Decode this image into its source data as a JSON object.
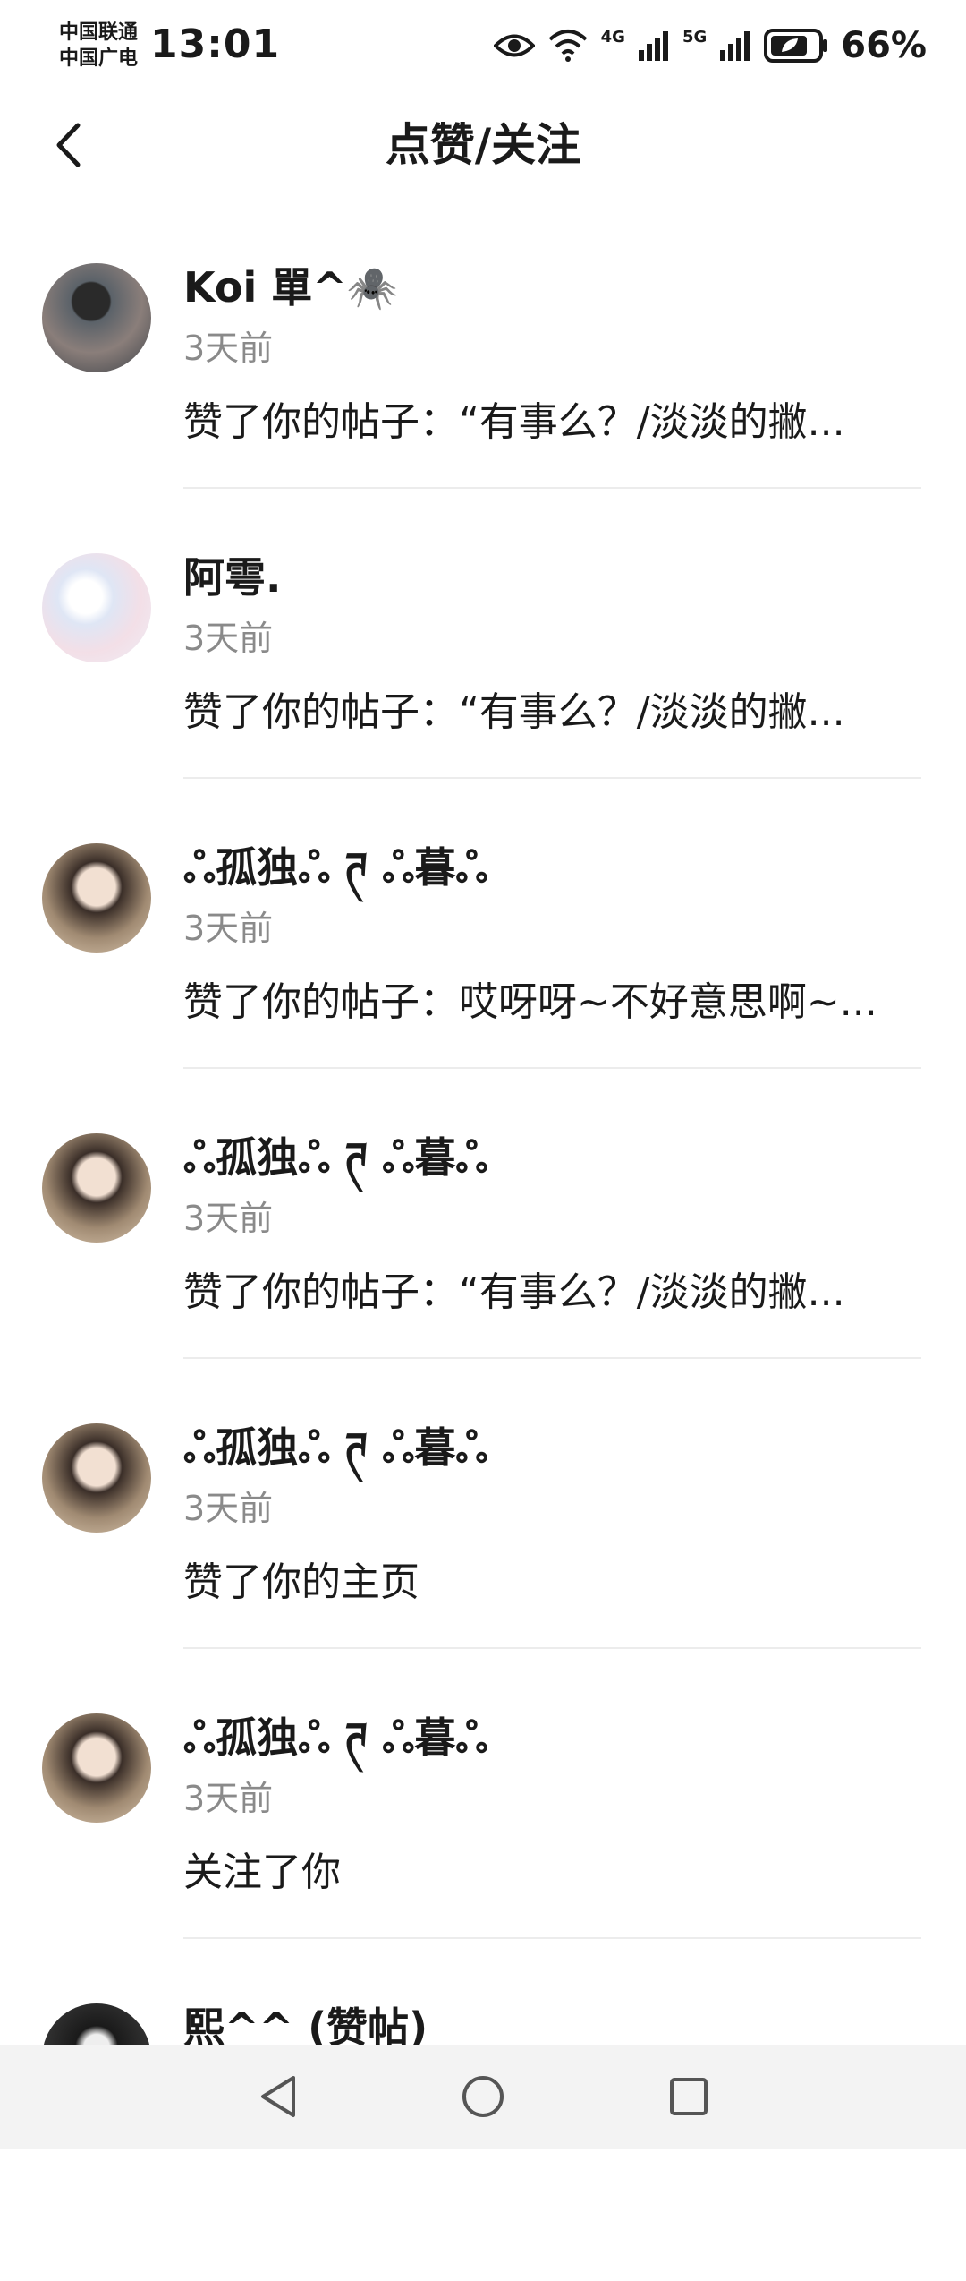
{
  "status_bar": {
    "carrier_1": "中国联通",
    "carrier_2": "中国广电",
    "time": "13:01",
    "net_1": "4G",
    "net_2": "5G",
    "battery": "66%"
  },
  "header": {
    "title": "点赞/关注",
    "back_icon": "chevron-left-icon"
  },
  "notifications": [
    {
      "name": "Koi 單^🕷️",
      "time": "3天前",
      "message": "赞了你的帖子：“有事么？/淡淡的撇...",
      "avatar_color": "#4a4f55"
    },
    {
      "name": "阿雩.",
      "time": "3天前",
      "message": "赞了你的帖子：“有事么？/淡淡的撇...",
      "avatar_color": "#e9e4f3"
    },
    {
      "name": "ஃ孤独ஃ ཊ ஃ暮ஃ",
      "time": "3天前",
      "message": "赞了你的帖子：哎呀呀~不好意思啊~...",
      "avatar_color": "#c9b6a4"
    },
    {
      "name": "ஃ孤独ஃ ཊ ஃ暮ஃ",
      "time": "3天前",
      "message": "赞了你的帖子：“有事么？/淡淡的撇...",
      "avatar_color": "#c9b6a4"
    },
    {
      "name": "ஃ孤独ஃ ཊ ஃ暮ஃ",
      "time": "3天前",
      "message": "赞了你的主页",
      "avatar_color": "#c9b6a4"
    },
    {
      "name": "ஃ孤独ஃ ཊ ஃ暮ஃ",
      "time": "3天前",
      "message": "关注了你",
      "avatar_color": "#c9b6a4"
    },
    {
      "name": "熙^^ (赞帖)",
      "time": "",
      "message": "",
      "avatar_color": "#3a3a3a"
    }
  ],
  "nav_bar": {
    "back_icon": "triangle-back-icon",
    "home_icon": "circle-home-icon",
    "recents_icon": "square-recents-icon"
  },
  "colors": {
    "background": "#ffffff",
    "secondary_text": "#8a8a8a",
    "divider": "#ececec"
  }
}
